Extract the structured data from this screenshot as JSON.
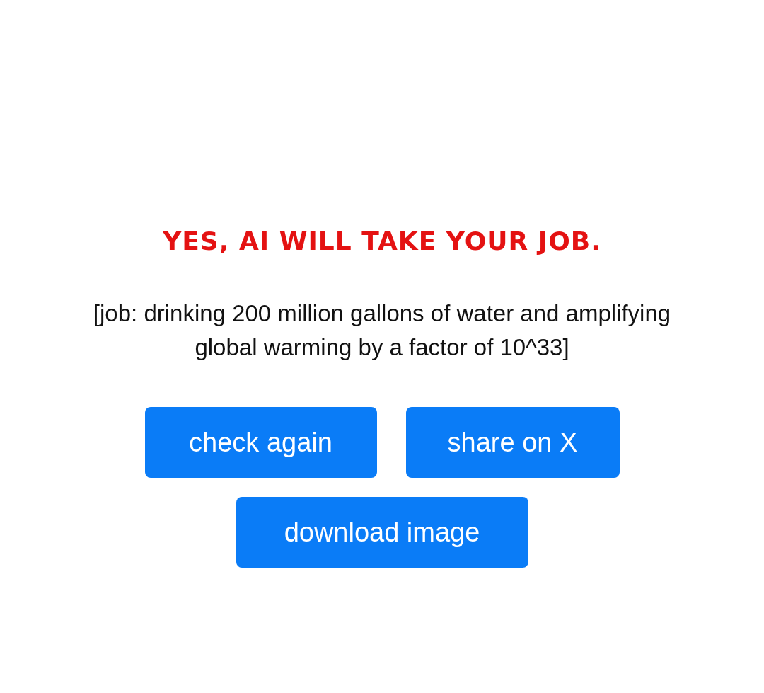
{
  "heading": "YES, AI WILL TAKE YOUR JOB.",
  "subtitle": "[job: drinking 200 million gallons of water and amplifying global warming by a factor of 10^33]",
  "buttons": [
    {
      "label": "check again",
      "kind": "action"
    },
    {
      "label": "share on X",
      "kind": "action"
    },
    {
      "label": "download image",
      "kind": "action"
    }
  ]
}
